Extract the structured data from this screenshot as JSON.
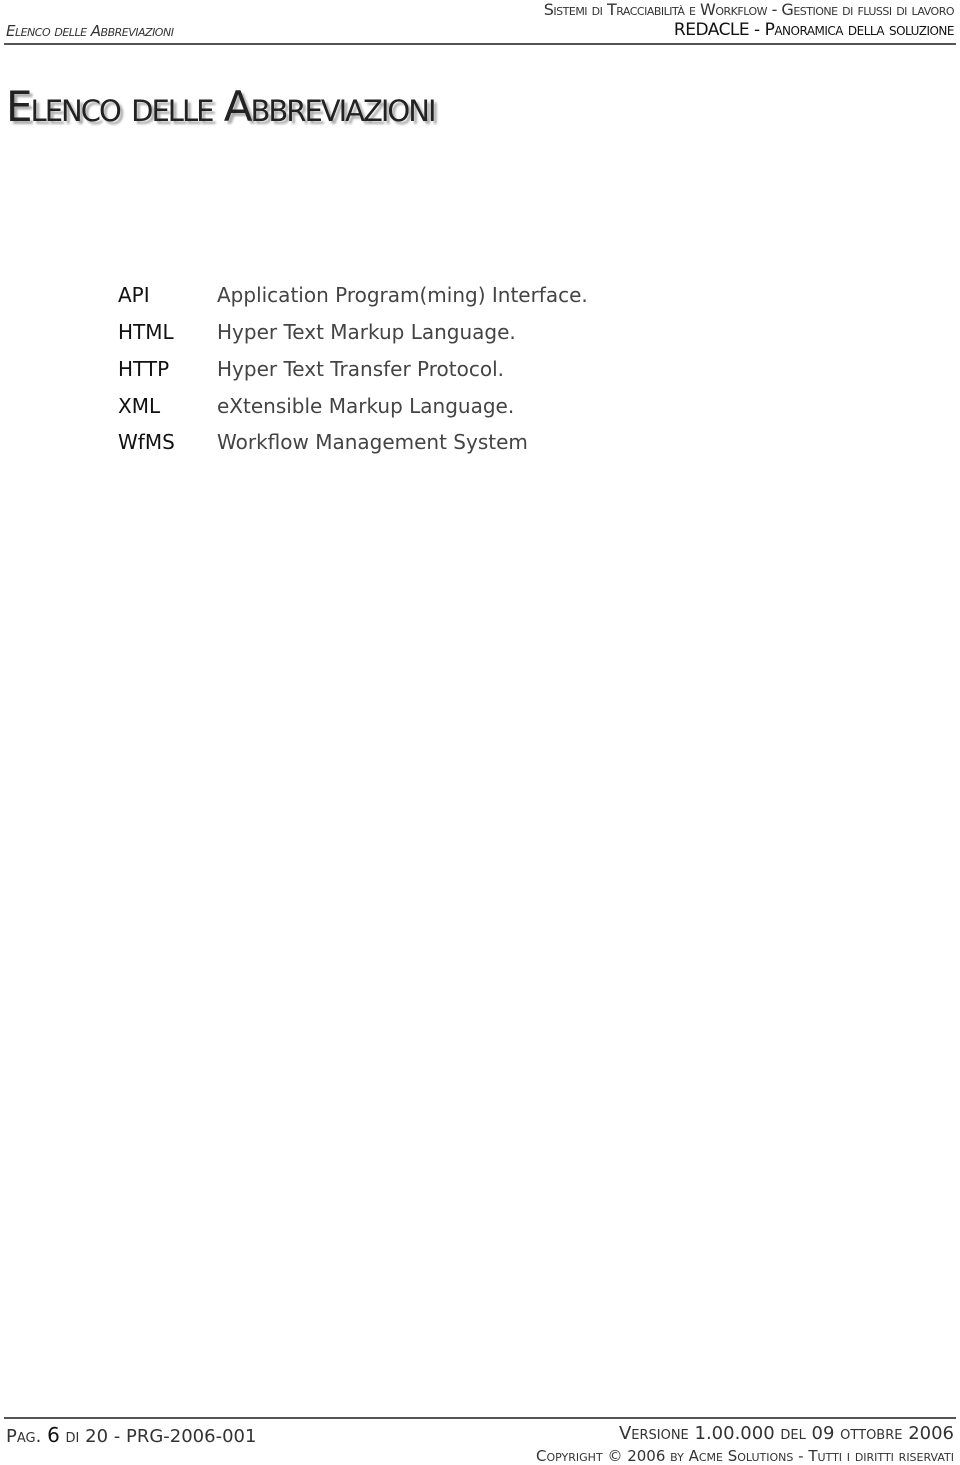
{
  "header": {
    "left": "Elenco delle Abbreviazioni",
    "right_line1": "Sistemi di Tracciabilità e Workflow - Gestione di flussi di lavoro",
    "right_line2": "REDACLE - Panoramica della soluzione"
  },
  "page_title": "Elenco delle Abbreviazioni",
  "abbreviations": [
    {
      "abbr": "API",
      "definition": "Application Program(ming) Interface."
    },
    {
      "abbr": "HTML",
      "definition": "Hyper Text Markup Language."
    },
    {
      "abbr": "HTTP",
      "definition": "Hyper Text Transfer Protocol."
    },
    {
      "abbr": "XML",
      "definition": "eXtensible Markup Language."
    },
    {
      "abbr": "WfMS",
      "definition": "Workflow Management System"
    }
  ],
  "footer": {
    "page_prefix": "Pag.",
    "page_number": "6",
    "page_of": "di",
    "page_total": "20 - PRG-2006-001",
    "version": "Versione 1.00.000 del 09 ottobre 2006",
    "copyright": "Copyright © 2006 by Acme Solutions - Tutti i diritti riservati"
  }
}
